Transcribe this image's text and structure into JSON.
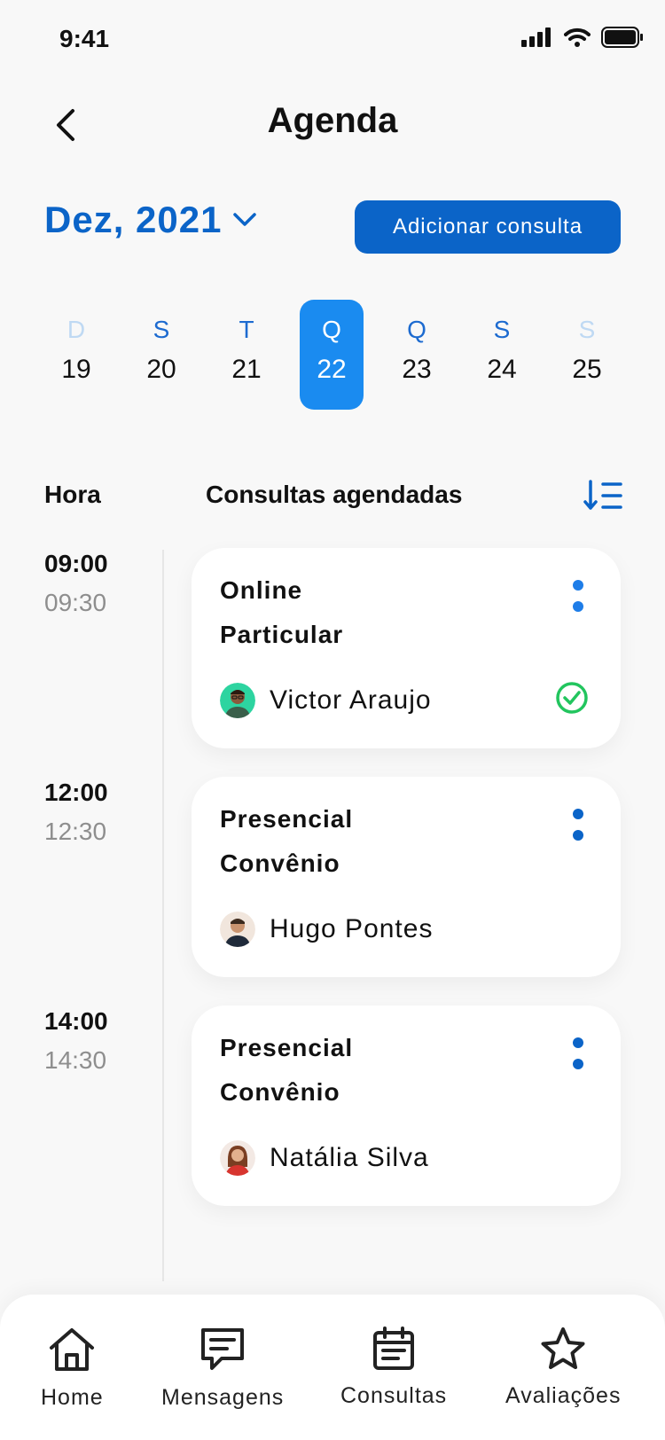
{
  "status_bar": {
    "time": "9:41"
  },
  "header": {
    "title": "Agenda"
  },
  "month": {
    "label": "Dez, 2021"
  },
  "actions": {
    "add_label": "Adicionar consulta"
  },
  "week": [
    {
      "letter": "D",
      "number": "19",
      "state": "muted"
    },
    {
      "letter": "S",
      "number": "20",
      "state": "normal"
    },
    {
      "letter": "T",
      "number": "21",
      "state": "normal"
    },
    {
      "letter": "Q",
      "number": "22",
      "state": "selected"
    },
    {
      "letter": "Q",
      "number": "23",
      "state": "normal"
    },
    {
      "letter": "S",
      "number": "24",
      "state": "normal"
    },
    {
      "letter": "S",
      "number": "25",
      "state": "muted"
    }
  ],
  "columns": {
    "hora": "Hora",
    "consultas": "Consultas agendadas"
  },
  "appointments": [
    {
      "start": "09:00",
      "end": "09:30",
      "type": "Online",
      "plan": "Particular",
      "patient": "Victor Araujo",
      "confirmed": true
    },
    {
      "start": "12:00",
      "end": "12:30",
      "type": "Presencial",
      "plan": "Convênio",
      "patient": "Hugo Pontes",
      "confirmed": false
    },
    {
      "start": "14:00",
      "end": "14:30",
      "type": "Presencial",
      "plan": "Convênio",
      "patient": "Natália Silva",
      "confirmed": false
    }
  ],
  "nav": [
    {
      "label": "Home",
      "icon": "home-icon"
    },
    {
      "label": "Mensagens",
      "icon": "message-icon"
    },
    {
      "label": "Consultas",
      "icon": "calendar-icon"
    },
    {
      "label": "Avaliações",
      "icon": "star-icon"
    }
  ],
  "colors": {
    "primary": "#0B64C8",
    "selected_day": "#1A8BF0",
    "confirmed": "#22C55E",
    "background": "#F8F8F8"
  }
}
